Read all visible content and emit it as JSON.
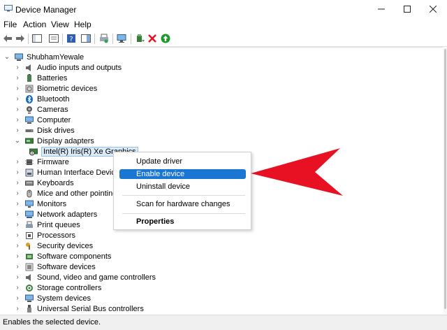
{
  "window": {
    "title": "Device Manager",
    "controls": [
      "minimize-icon",
      "maximize-icon",
      "close-icon"
    ]
  },
  "menubar": [
    "File",
    "Action",
    "View",
    "Help"
  ],
  "toolbar": {
    "icons": [
      "back-arrow-icon",
      "forward-arrow-icon",
      "show-hide-console-tree-icon",
      "properties-sheet-icon",
      "help-icon",
      "action-pane-icon",
      "print-icon",
      "monitor-icon",
      "update-driver-icon",
      "uninstall-icon",
      "enable-device-icon"
    ],
    "colors": {
      "uninstall": "#e81123",
      "enable": "#1a9a2b"
    }
  },
  "tree": {
    "root": "ShubhamYewale",
    "categories": [
      "Audio inputs and outputs",
      "Batteries",
      "Biometric devices",
      "Bluetooth",
      "Cameras",
      "Computer",
      "Disk drives",
      "Display adapters",
      "Firmware",
      "Human Interface Devices",
      "Keyboards",
      "Mice and other pointing",
      "Monitors",
      "Network adapters",
      "Print queues",
      "Processors",
      "Security devices",
      "Software components",
      "Software devices",
      "Sound, video and game controllers",
      "Storage controllers",
      "System devices",
      "Universal Serial Bus controllers"
    ],
    "expanded_child": "Intel(R) Iris(R) Xe Graphics"
  },
  "context_menu": {
    "items": [
      "Update driver",
      "Enable device",
      "Uninstall device",
      "Scan for hardware changes",
      "Properties"
    ],
    "highlighted": "Enable device",
    "accent": "#1976d2"
  },
  "annotation": {
    "arrow_color": "#e81123"
  },
  "status_bar": {
    "text": "Enables the selected device."
  }
}
